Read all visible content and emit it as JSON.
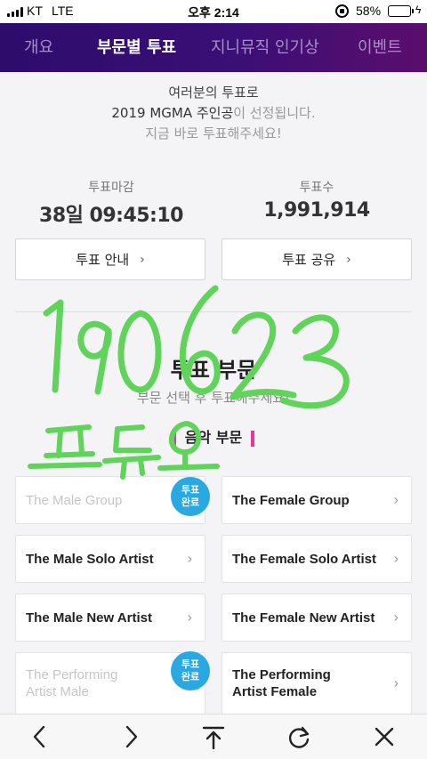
{
  "status_bar": {
    "carrier": "KT",
    "network": "LTE",
    "time": "오후 2:14",
    "battery_percent": "58%",
    "battery_level": 0.58
  },
  "tabs": [
    {
      "label": "개요",
      "active": false
    },
    {
      "label": "부문별 투표",
      "active": true
    },
    {
      "label": "지니뮤직 인기상",
      "active": false
    },
    {
      "label": "이벤트",
      "active": false
    }
  ],
  "intro": {
    "line1": "여러분의 투표로",
    "line2_highlight": "2019 MGMA 주인공",
    "line2_rest": "이 선정됩니다.",
    "line3": "지금 바로 투표해주세요!"
  },
  "stats": {
    "deadline_label": "투표마감",
    "deadline_value": "38일 09:45:10",
    "votes_label": "투표수",
    "votes_value": "1,991,914"
  },
  "buttons": {
    "guide": "투표 안내",
    "share": "투표 공유"
  },
  "section": {
    "title": "투표 부문",
    "subtitle": "부문 선택 후 투표해주세요!",
    "category": "음악 부문"
  },
  "done_badge": {
    "line1": "투표",
    "line2": "완료"
  },
  "categories": [
    {
      "label": "The Male Group",
      "done": true
    },
    {
      "label": "The Female Group",
      "done": false
    },
    {
      "label": "The Male Solo Artist",
      "done": false
    },
    {
      "label": "The Female Solo Artist",
      "done": false
    },
    {
      "label": "The Male New Artist",
      "done": false
    },
    {
      "label": "The Female New Artist",
      "done": false
    },
    {
      "label": "The Performing Artist Male",
      "line1": "The Performing",
      "line2": "Artist Male",
      "done": true
    },
    {
      "label": "The Performing Artist Female",
      "line1": "The Performing",
      "line2": "Artist Female",
      "done": false
    }
  ],
  "handwriting": {
    "date": "190623",
    "word": "프듀오"
  },
  "colors": {
    "tab_gradient_start": "#2d0c6c",
    "tab_gradient_end": "#5b0d6c",
    "badge_blue": "#2aa8e1",
    "category_pink": "#e8369b",
    "scribble_green": "#5fd35a",
    "battery_green": "#4cd964"
  },
  "toolbar_icons": [
    "back-icon",
    "forward-icon",
    "share-icon",
    "reload-icon",
    "close-icon"
  ]
}
